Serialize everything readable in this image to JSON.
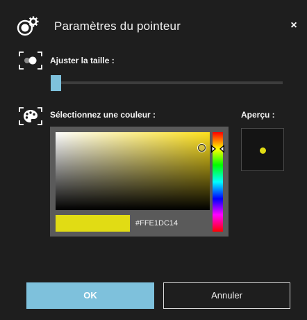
{
  "dialog": {
    "title": "Paramètres du pointeur",
    "close_label": "×",
    "header_icon": "gear-pointer-icon"
  },
  "size": {
    "label": "Ajuster la taille :",
    "icon": "pointer-size-icon",
    "slider_value_percent": 4
  },
  "color": {
    "label": "Sélectionnez une couleur :",
    "icon": "palette-icon",
    "hex": "#FFE1DC14",
    "selected_color": "#E1DC14",
    "hue_base": "#FFE11D"
  },
  "preview": {
    "label": "Aperçu :",
    "dot_color": "#E1DC14"
  },
  "buttons": {
    "ok": "OK",
    "cancel": "Annuler"
  },
  "colors": {
    "background": "#1E1E1E",
    "accent": "#7EC1DC",
    "panel": "#5A5A5A"
  }
}
